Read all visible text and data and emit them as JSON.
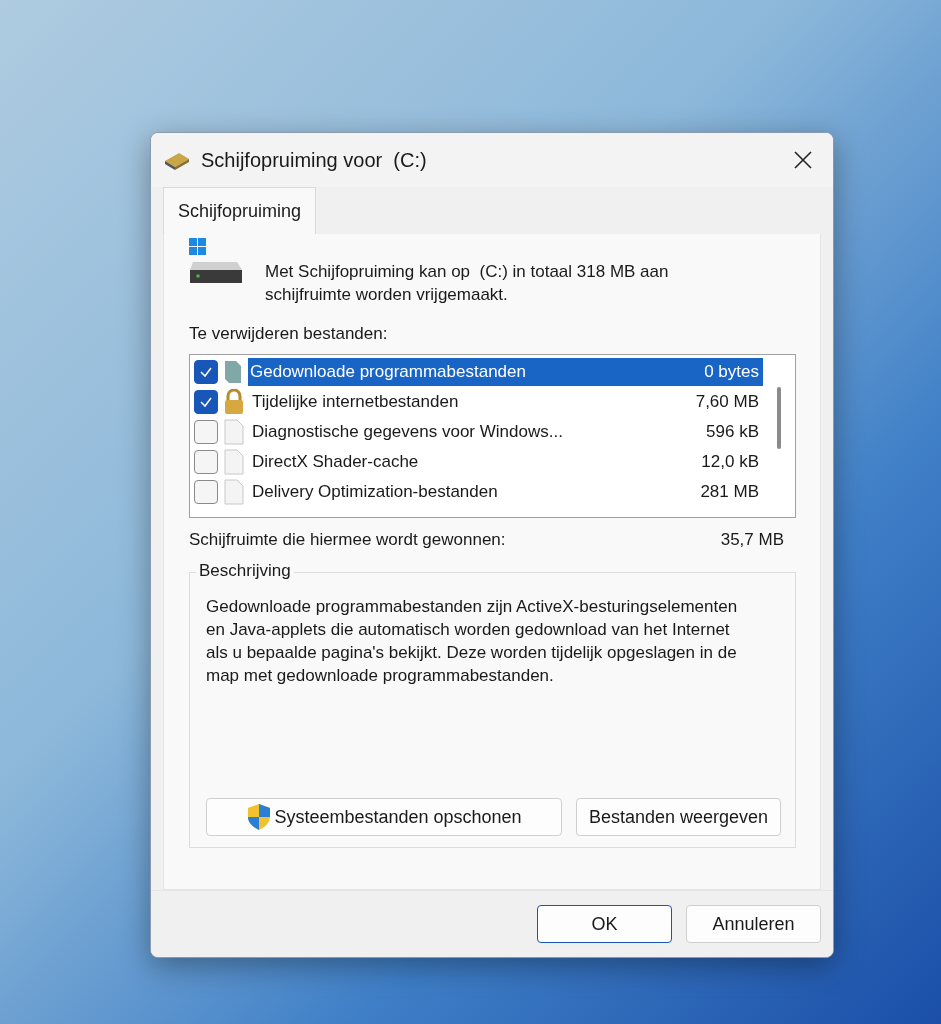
{
  "window": {
    "title": "Schijfopruiming voor  (C:)"
  },
  "tabs": [
    {
      "label": "Schijfopruiming",
      "selected": true
    }
  ],
  "intro": "Met Schijfopruiming kan op  (C:) in totaal 318 MB aan schijfruimte worden vrijgemaakt.",
  "list_label": "Te verwijderen bestanden:",
  "files": [
    {
      "kind": "folder",
      "name": "Gedownloade programmabestanden",
      "size": "0 bytes",
      "checked": true,
      "selected": true
    },
    {
      "kind": "lock",
      "name": "Tijdelijke internetbestanden",
      "size": "7,60 MB",
      "checked": true,
      "selected": false
    },
    {
      "kind": "file",
      "name": "Diagnostische gegevens voor Windows...",
      "size": "596 kB",
      "checked": false,
      "selected": false
    },
    {
      "kind": "file",
      "name": "DirectX Shader-cache",
      "size": "12,0 kB",
      "checked": false,
      "selected": false
    },
    {
      "kind": "file",
      "name": "Delivery Optimization-bestanden",
      "size": "281 MB",
      "checked": false,
      "selected": false
    }
  ],
  "gained": {
    "label": "Schijfruimte die hiermee wordt gewonnen:",
    "value": "35,7 MB"
  },
  "description": {
    "legend": "Beschrijving",
    "text": "Gedownloade programmabestanden zijn ActiveX-besturingselementen en Java-applets die automatisch worden gedownload van het Internet als u bepaalde pagina's bekijkt. Deze worden tijdelijk opgeslagen in de map met gedownloade programmabestanden."
  },
  "actions": [
    {
      "label": "Systeembestanden opschonen",
      "shield": true
    },
    {
      "label": "Bestanden weergeven",
      "shield": false
    }
  ],
  "buttons": [
    {
      "label": "OK",
      "default": true
    },
    {
      "label": "Annuleren",
      "default": false
    }
  ]
}
